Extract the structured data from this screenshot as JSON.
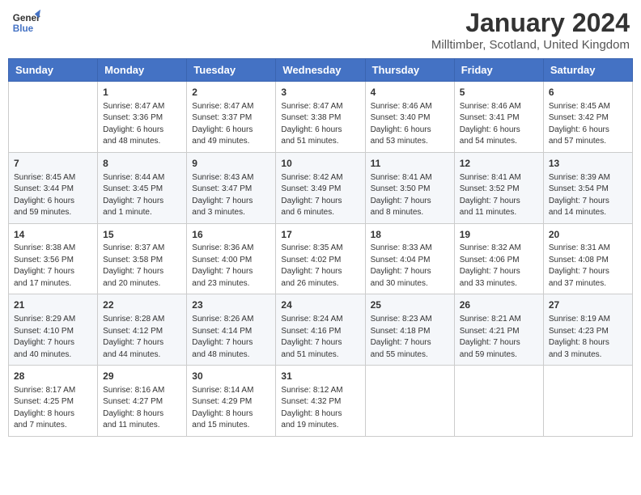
{
  "header": {
    "logo_line1": "General",
    "logo_line2": "Blue",
    "month": "January 2024",
    "location": "Milltimber, Scotland, United Kingdom"
  },
  "weekdays": [
    "Sunday",
    "Monday",
    "Tuesday",
    "Wednesday",
    "Thursday",
    "Friday",
    "Saturday"
  ],
  "weeks": [
    [
      {
        "day": "",
        "text": ""
      },
      {
        "day": "1",
        "text": "Sunrise: 8:47 AM\nSunset: 3:36 PM\nDaylight: 6 hours\nand 48 minutes."
      },
      {
        "day": "2",
        "text": "Sunrise: 8:47 AM\nSunset: 3:37 PM\nDaylight: 6 hours\nand 49 minutes."
      },
      {
        "day": "3",
        "text": "Sunrise: 8:47 AM\nSunset: 3:38 PM\nDaylight: 6 hours\nand 51 minutes."
      },
      {
        "day": "4",
        "text": "Sunrise: 8:46 AM\nSunset: 3:40 PM\nDaylight: 6 hours\nand 53 minutes."
      },
      {
        "day": "5",
        "text": "Sunrise: 8:46 AM\nSunset: 3:41 PM\nDaylight: 6 hours\nand 54 minutes."
      },
      {
        "day": "6",
        "text": "Sunrise: 8:45 AM\nSunset: 3:42 PM\nDaylight: 6 hours\nand 57 minutes."
      }
    ],
    [
      {
        "day": "7",
        "text": "Sunrise: 8:45 AM\nSunset: 3:44 PM\nDaylight: 6 hours\nand 59 minutes."
      },
      {
        "day": "8",
        "text": "Sunrise: 8:44 AM\nSunset: 3:45 PM\nDaylight: 7 hours\nand 1 minute."
      },
      {
        "day": "9",
        "text": "Sunrise: 8:43 AM\nSunset: 3:47 PM\nDaylight: 7 hours\nand 3 minutes."
      },
      {
        "day": "10",
        "text": "Sunrise: 8:42 AM\nSunset: 3:49 PM\nDaylight: 7 hours\nand 6 minutes."
      },
      {
        "day": "11",
        "text": "Sunrise: 8:41 AM\nSunset: 3:50 PM\nDaylight: 7 hours\nand 8 minutes."
      },
      {
        "day": "12",
        "text": "Sunrise: 8:41 AM\nSunset: 3:52 PM\nDaylight: 7 hours\nand 11 minutes."
      },
      {
        "day": "13",
        "text": "Sunrise: 8:39 AM\nSunset: 3:54 PM\nDaylight: 7 hours\nand 14 minutes."
      }
    ],
    [
      {
        "day": "14",
        "text": "Sunrise: 8:38 AM\nSunset: 3:56 PM\nDaylight: 7 hours\nand 17 minutes."
      },
      {
        "day": "15",
        "text": "Sunrise: 8:37 AM\nSunset: 3:58 PM\nDaylight: 7 hours\nand 20 minutes."
      },
      {
        "day": "16",
        "text": "Sunrise: 8:36 AM\nSunset: 4:00 PM\nDaylight: 7 hours\nand 23 minutes."
      },
      {
        "day": "17",
        "text": "Sunrise: 8:35 AM\nSunset: 4:02 PM\nDaylight: 7 hours\nand 26 minutes."
      },
      {
        "day": "18",
        "text": "Sunrise: 8:33 AM\nSunset: 4:04 PM\nDaylight: 7 hours\nand 30 minutes."
      },
      {
        "day": "19",
        "text": "Sunrise: 8:32 AM\nSunset: 4:06 PM\nDaylight: 7 hours\nand 33 minutes."
      },
      {
        "day": "20",
        "text": "Sunrise: 8:31 AM\nSunset: 4:08 PM\nDaylight: 7 hours\nand 37 minutes."
      }
    ],
    [
      {
        "day": "21",
        "text": "Sunrise: 8:29 AM\nSunset: 4:10 PM\nDaylight: 7 hours\nand 40 minutes."
      },
      {
        "day": "22",
        "text": "Sunrise: 8:28 AM\nSunset: 4:12 PM\nDaylight: 7 hours\nand 44 minutes."
      },
      {
        "day": "23",
        "text": "Sunrise: 8:26 AM\nSunset: 4:14 PM\nDaylight: 7 hours\nand 48 minutes."
      },
      {
        "day": "24",
        "text": "Sunrise: 8:24 AM\nSunset: 4:16 PM\nDaylight: 7 hours\nand 51 minutes."
      },
      {
        "day": "25",
        "text": "Sunrise: 8:23 AM\nSunset: 4:18 PM\nDaylight: 7 hours\nand 55 minutes."
      },
      {
        "day": "26",
        "text": "Sunrise: 8:21 AM\nSunset: 4:21 PM\nDaylight: 7 hours\nand 59 minutes."
      },
      {
        "day": "27",
        "text": "Sunrise: 8:19 AM\nSunset: 4:23 PM\nDaylight: 8 hours\nand 3 minutes."
      }
    ],
    [
      {
        "day": "28",
        "text": "Sunrise: 8:17 AM\nSunset: 4:25 PM\nDaylight: 8 hours\nand 7 minutes."
      },
      {
        "day": "29",
        "text": "Sunrise: 8:16 AM\nSunset: 4:27 PM\nDaylight: 8 hours\nand 11 minutes."
      },
      {
        "day": "30",
        "text": "Sunrise: 8:14 AM\nSunset: 4:29 PM\nDaylight: 8 hours\nand 15 minutes."
      },
      {
        "day": "31",
        "text": "Sunrise: 8:12 AM\nSunset: 4:32 PM\nDaylight: 8 hours\nand 19 minutes."
      },
      {
        "day": "",
        "text": ""
      },
      {
        "day": "",
        "text": ""
      },
      {
        "day": "",
        "text": ""
      }
    ]
  ]
}
